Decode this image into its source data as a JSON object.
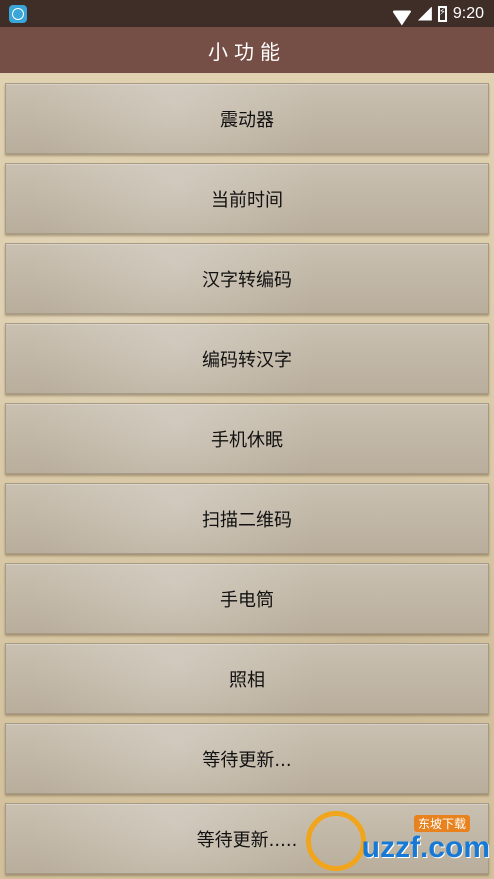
{
  "status_bar": {
    "time": "9:20"
  },
  "title_bar": {
    "title": "小功能"
  },
  "menu": {
    "items": [
      {
        "label": "震动器"
      },
      {
        "label": "当前时间"
      },
      {
        "label": "汉字转编码"
      },
      {
        "label": "编码转汉字"
      },
      {
        "label": "手机休眠"
      },
      {
        "label": "扫描二维码"
      },
      {
        "label": "手电筒"
      },
      {
        "label": "照相"
      },
      {
        "label": "等待更新..."
      },
      {
        "label": "等待更新....."
      }
    ]
  },
  "watermark": {
    "brand": "uzzf.com",
    "tag": "东坡下载"
  }
}
